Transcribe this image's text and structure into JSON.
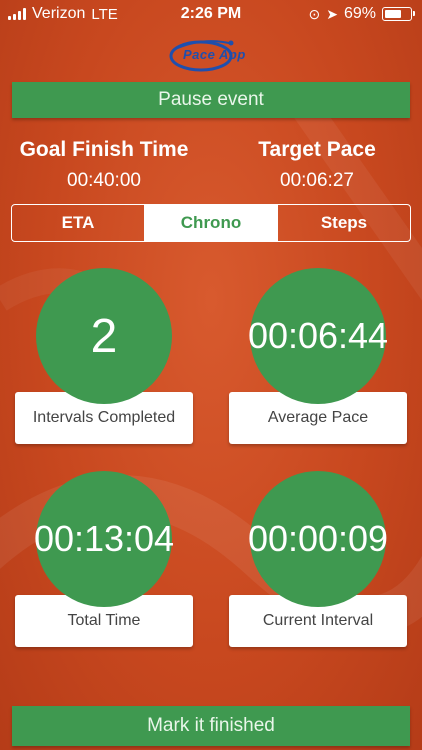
{
  "status": {
    "carrier": "Verizon",
    "network": "LTE",
    "time": "2:26 PM",
    "battery": "69%",
    "battery_level": 0.69
  },
  "logo": {
    "text": "Pace App"
  },
  "pause_label": "Pause event",
  "goal_finish": {
    "label": "Goal Finish Time",
    "value": "00:40:00"
  },
  "target_pace": {
    "label": "Target Pace",
    "value": "00:06:27"
  },
  "tabs": [
    {
      "label": "ETA",
      "active": false
    },
    {
      "label": "Chrono",
      "active": true
    },
    {
      "label": "Steps",
      "active": false
    }
  ],
  "stats": [
    {
      "value": "2",
      "label": "Intervals Completed"
    },
    {
      "value": "00:06:44",
      "label": "Average Pace"
    },
    {
      "value": "00:13:04",
      "label": "Total Time"
    },
    {
      "value": "00:00:09",
      "label": "Current Interval"
    }
  ],
  "finish_label": "Mark it finished",
  "colors": {
    "accent": "#3f9950",
    "background": "#c8481f"
  }
}
